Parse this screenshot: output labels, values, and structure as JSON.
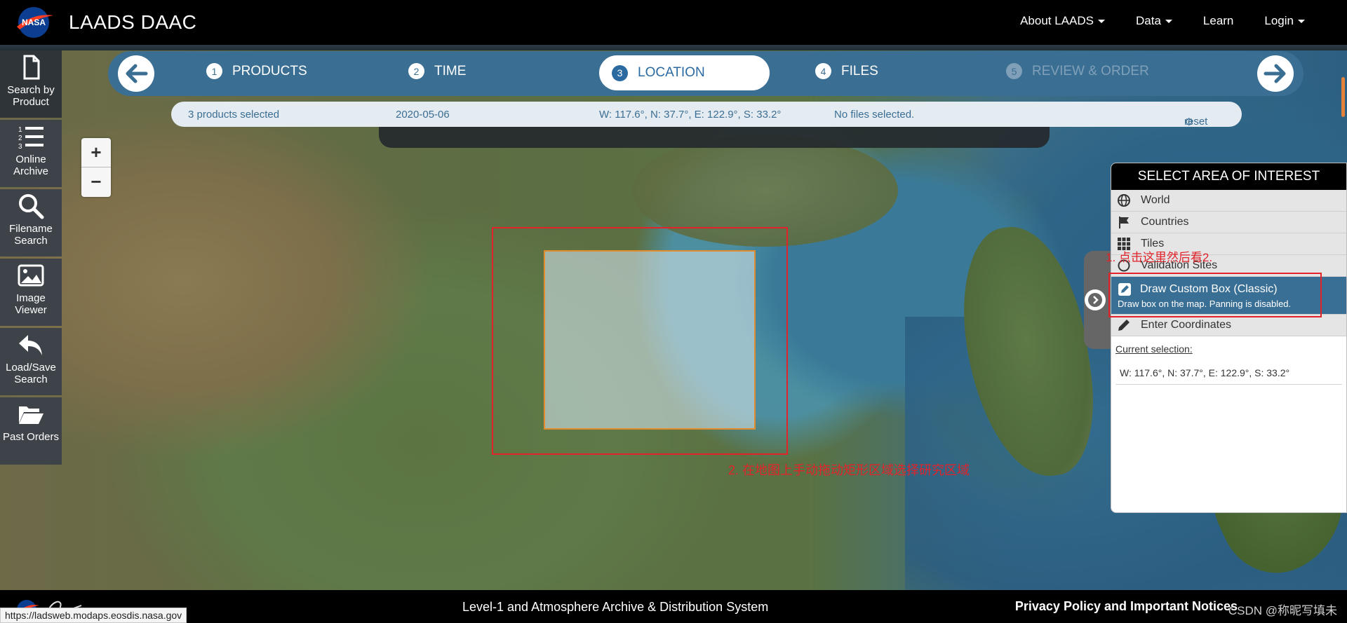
{
  "header": {
    "brand": "LAADS DAAC",
    "nav": [
      {
        "label": "About LAADS",
        "dropdown": true
      },
      {
        "label": "Data",
        "dropdown": true
      },
      {
        "label": "Learn",
        "dropdown": false
      },
      {
        "label": "Login",
        "dropdown": true
      }
    ]
  },
  "sidebar": {
    "items": [
      {
        "label_line1": "Search by",
        "label_line2": "Product",
        "icon": "document-icon"
      },
      {
        "label_line1": "Online",
        "label_line2": "Archive",
        "icon": "list-icon"
      },
      {
        "label_line1": "Filename",
        "label_line2": "Search",
        "icon": "search-icon"
      },
      {
        "label_line1": "Image",
        "label_line2": "Viewer",
        "icon": "image-icon"
      },
      {
        "label_line1": "Load/Save",
        "label_line2": "Search",
        "icon": "reply-icon"
      },
      {
        "label_line1": "Past Orders",
        "label_line2": "",
        "icon": "folder-open-icon"
      }
    ]
  },
  "wizard": {
    "steps": [
      {
        "num": "1",
        "label": "PRODUCTS"
      },
      {
        "num": "2",
        "label": "TIME"
      },
      {
        "num": "3",
        "label": "LOCATION"
      },
      {
        "num": "4",
        "label": "FILES"
      },
      {
        "num": "5",
        "label": "REVIEW & ORDER"
      }
    ],
    "current_step": 3
  },
  "summary": {
    "products": "3 products selected",
    "date": "2020-05-06",
    "location": "W: 117.6°, N: 37.7°, E: 122.9°, S: 33.2°",
    "files": "No files selected.",
    "reset": "reset"
  },
  "zoom": {
    "in": "+",
    "out": "−"
  },
  "aoi_panel": {
    "title": "SELECT AREA OF INTEREST",
    "items": [
      {
        "label": "World",
        "icon": "globe-icon"
      },
      {
        "label": "Countries",
        "icon": "flag-icon"
      },
      {
        "label": "Tiles",
        "icon": "grid-icon"
      },
      {
        "label": "Validation Sites",
        "icon": "circle-icon"
      }
    ],
    "selected": {
      "label": "Draw Custom Box (Classic)",
      "description": "Draw box on the map. Panning is disabled.",
      "icon": "edit-icon"
    },
    "after": {
      "label": "Enter Coordinates",
      "icon": "pencil-icon"
    },
    "current_selection_label": "Current selection:",
    "current_selection_value": "W: 117.6°, N: 37.7°, E: 122.9°, S: 33.2°"
  },
  "annotations": {
    "step1": "1. 点击这里然后看2.",
    "step2": "2. 在地图上手动拖动矩形区域选择研究区域"
  },
  "footer": {
    "title": "Level-1 and Atmosphere Archive & Distribution System",
    "privacy": "Privacy Policy and Important Notices",
    "watermark": "CSDN @称昵写填未",
    "status_url": "https://ladsweb.modaps.eosdis.nasa.gov"
  },
  "colors": {
    "accent_blue": "#3b6e93",
    "annotation_red": "#e2232a",
    "selection_border": "#e28c2e"
  }
}
